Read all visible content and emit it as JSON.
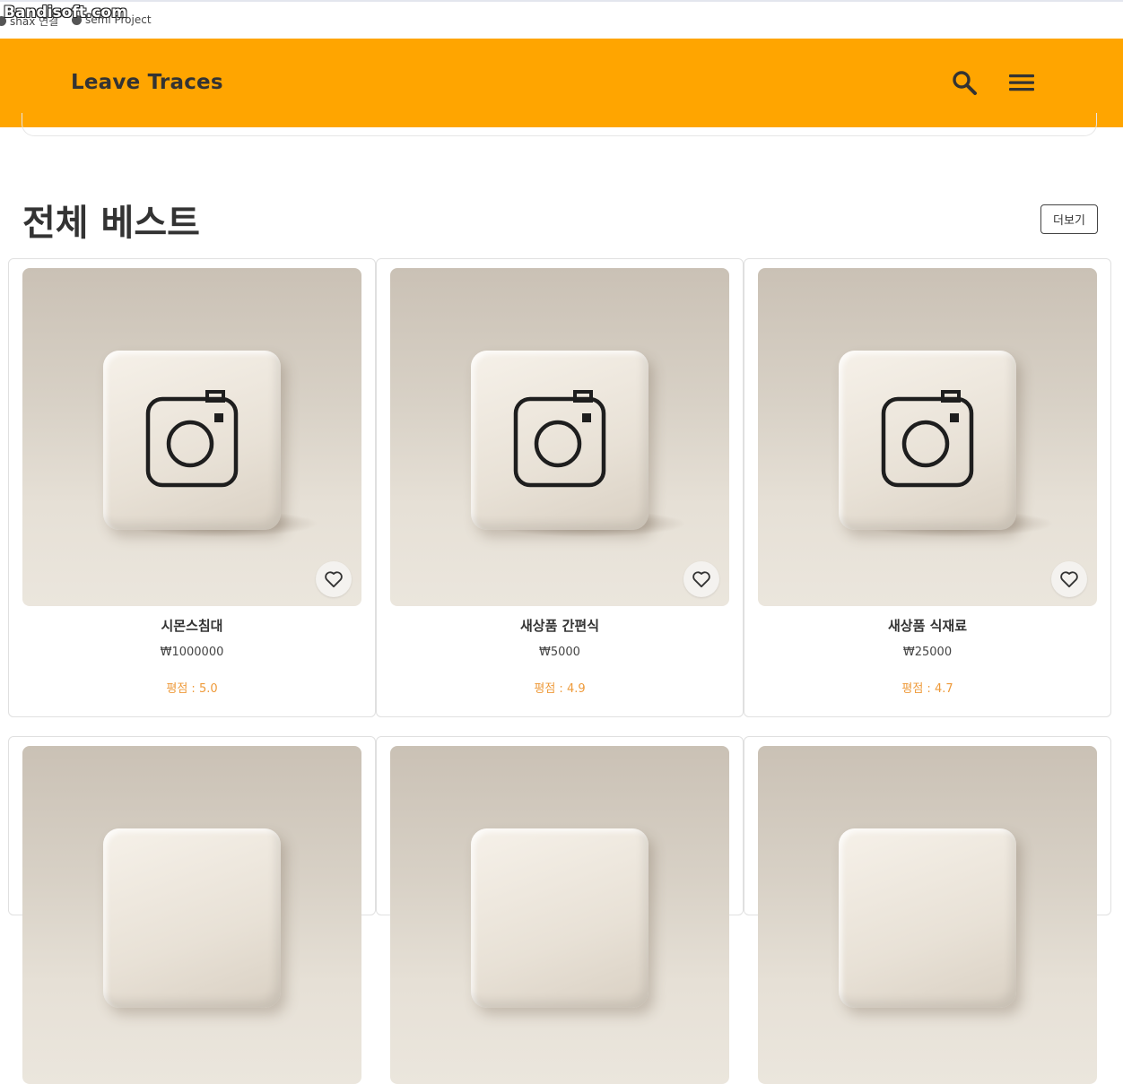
{
  "watermark": "Bandisoft.com",
  "bookmarks": [
    "shax 연결",
    "semi Project"
  ],
  "header": {
    "logo": "Leave Traces",
    "icons": [
      "search-icon",
      "menu-icon"
    ],
    "bg_color": "#ffa500"
  },
  "section": {
    "title": "전체 베스트",
    "more_label": "더보기"
  },
  "products": [
    {
      "name": "시몬스침대",
      "price": "₩1000000",
      "rating": "평점 : 5.0"
    },
    {
      "name": "새상품 간편식",
      "price": "₩5000",
      "rating": "평점 : 4.9"
    },
    {
      "name": "새상품 식재료",
      "price": "₩25000",
      "rating": "평점 : 4.7"
    }
  ],
  "colors": {
    "accent": "#ffa500",
    "rating": "#ee9a3a"
  }
}
